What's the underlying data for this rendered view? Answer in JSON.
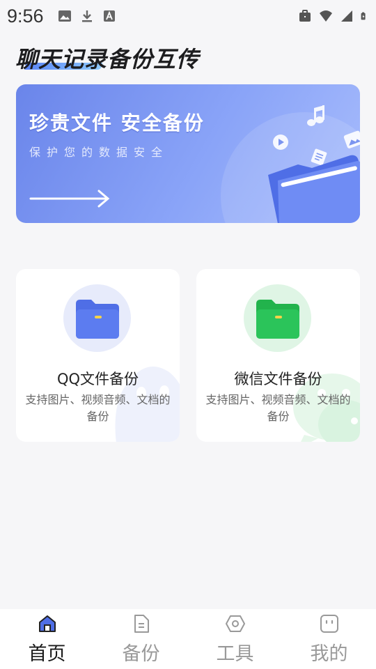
{
  "status_bar": {
    "time": "9:56",
    "left_icons": [
      "image-icon",
      "download-icon",
      "a-icon"
    ],
    "right_icons": [
      "briefcase-icon",
      "wifi-icon",
      "signal-icon",
      "battery-icon"
    ]
  },
  "page": {
    "title": "聊天记录备份互传"
  },
  "banner": {
    "title": "珍贵文件  安全备份",
    "subtitle": "保护您的数据安全",
    "accent_color": "#6a85ea"
  },
  "cards": [
    {
      "title": "QQ文件备份",
      "description": "支持图片、视频音频、文档的备份",
      "icon": "folder-blue-icon",
      "color": "#4f6ee6"
    },
    {
      "title": "微信文件备份",
      "description": "支持图片、视频音频、文档的备份",
      "icon": "folder-green-icon",
      "color": "#2bc45a"
    }
  ],
  "bottom_nav": {
    "active_index": 0,
    "items": [
      {
        "label": "首页",
        "icon": "home-icon"
      },
      {
        "label": "备份",
        "icon": "document-icon"
      },
      {
        "label": "工具",
        "icon": "hexagon-icon"
      },
      {
        "label": "我的",
        "icon": "profile-icon"
      }
    ]
  }
}
